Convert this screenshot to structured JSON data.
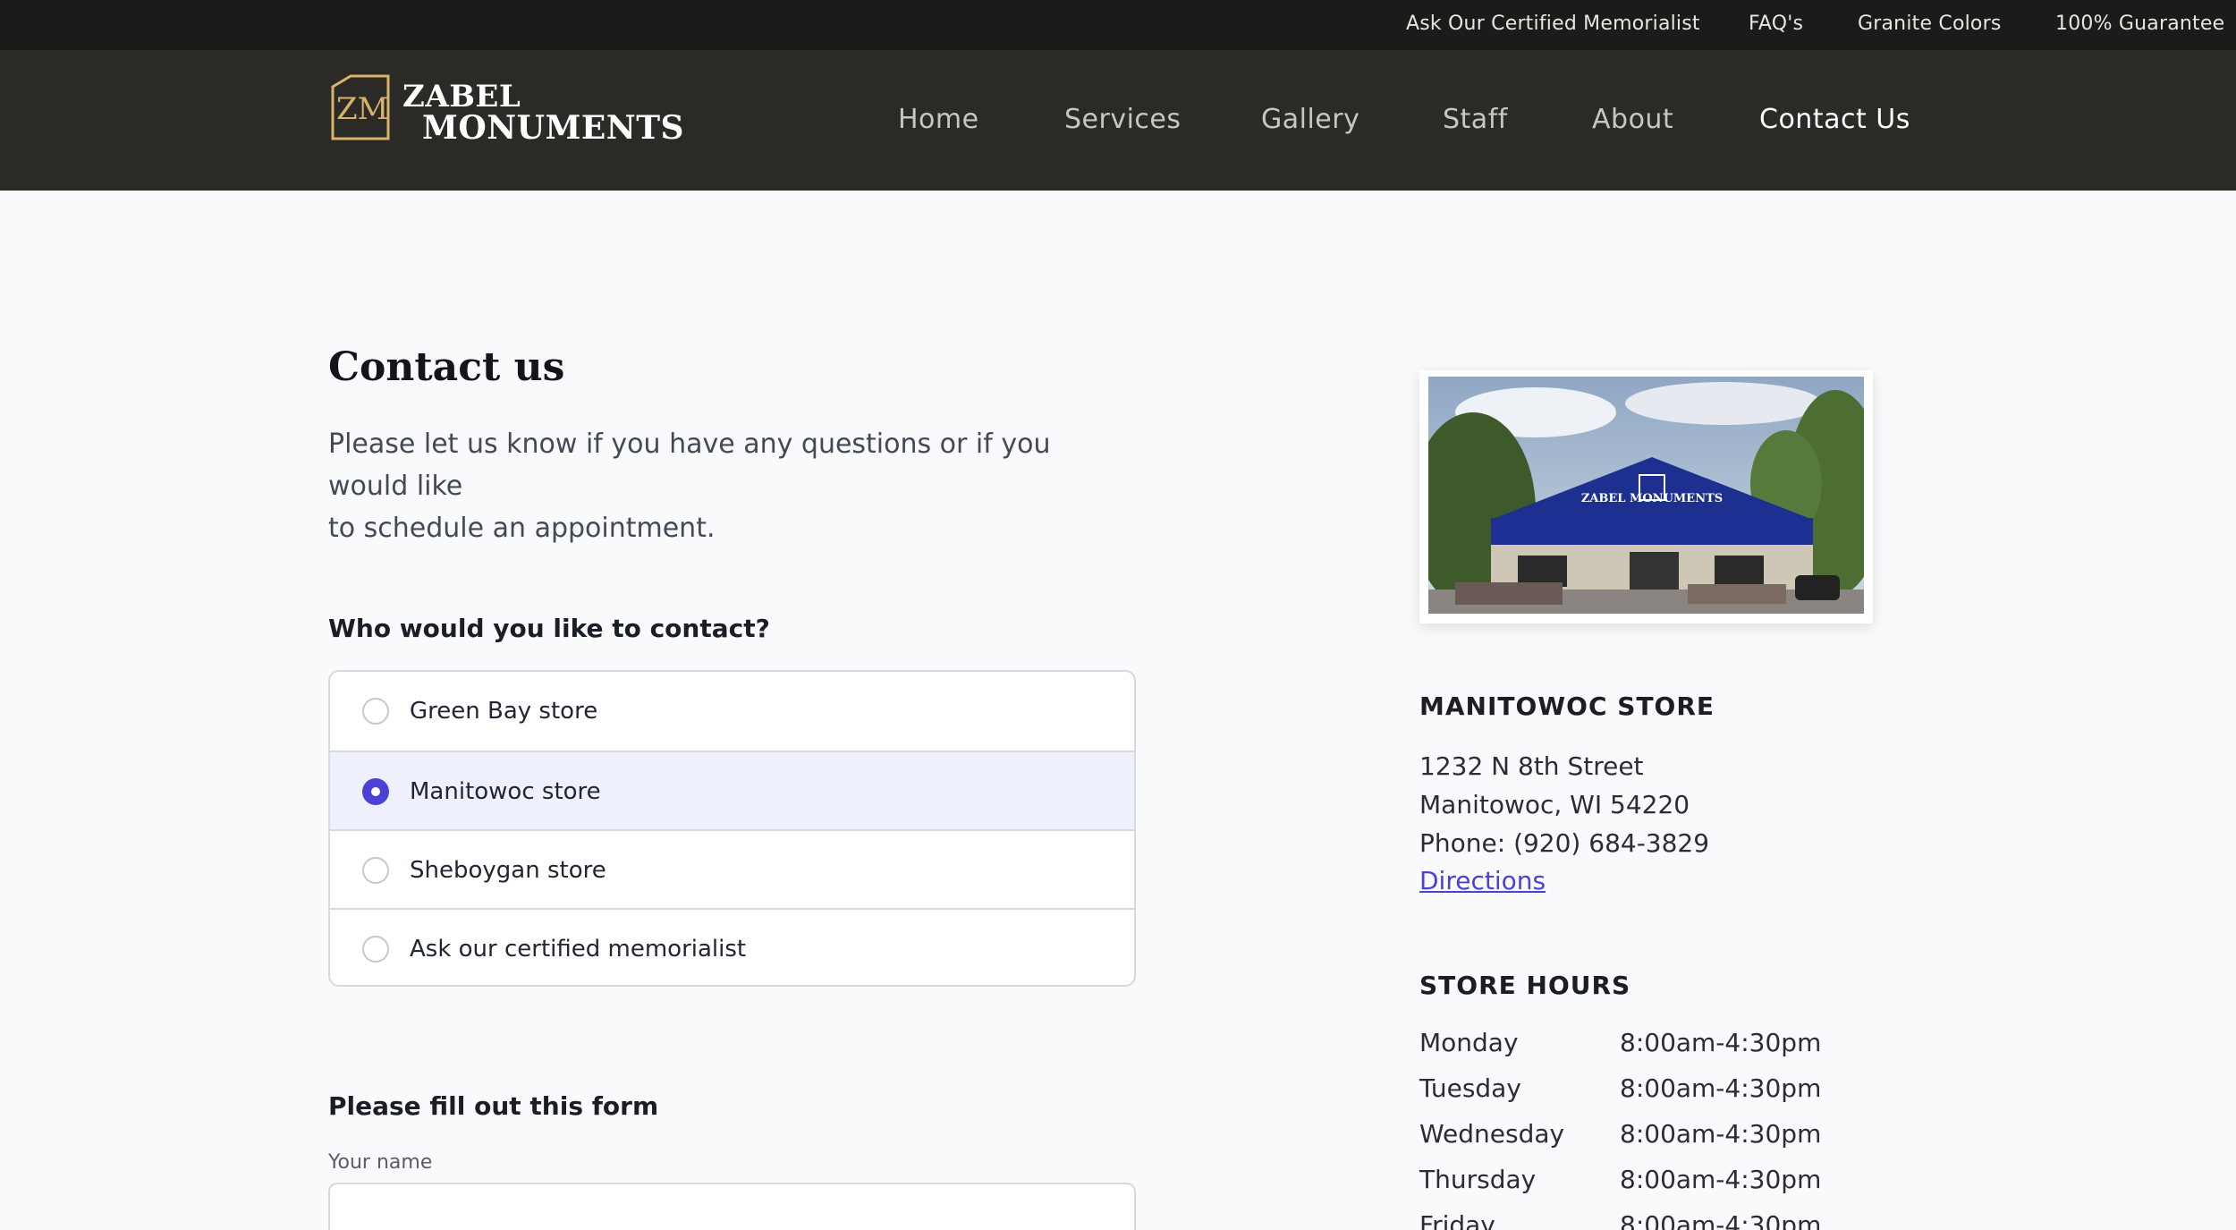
{
  "topbar": {
    "links": [
      "Ask Our Certified Memorialist",
      "FAQ's",
      "Granite Colors",
      "100% Guarantee"
    ]
  },
  "brand": {
    "monogram": "ZM",
    "line1": "ZABEL",
    "line2": "MONUMENTS",
    "accent_color": "#d9b26a"
  },
  "nav": {
    "items": [
      "Home",
      "Services",
      "Gallery",
      "Staff",
      "About",
      "Contact Us"
    ],
    "active": "Contact Us"
  },
  "main": {
    "title": "Contact us",
    "intro_line1": "Please let us know if you have any questions or if you would like",
    "intro_line2": "to schedule an appointment.",
    "contact_question": "Who would you like to contact?",
    "contact_options": [
      "Green Bay store",
      "Manitowoc store",
      "Sheboygan store",
      "Ask our certified memorialist"
    ],
    "selected_option": "Manitowoc store",
    "form_heading": "Please fill out this form",
    "name_label": "Your name",
    "name_value": ""
  },
  "store": {
    "photo_sign": "ZABEL MONUMENTS",
    "heading": "MANITOWOC STORE",
    "address_line1": "1232 N 8th Street",
    "address_line2": "Manitowoc, WI 54220",
    "phone": "Phone: (920) 684-3829",
    "directions_label": "Directions",
    "link_color": "#4a42d6"
  },
  "hours": {
    "heading": "STORE HOURS",
    "rows": [
      {
        "day": "Monday",
        "time": "8:00am-4:30pm"
      },
      {
        "day": "Tuesday",
        "time": "8:00am-4:30pm"
      },
      {
        "day": "Wednesday",
        "time": "8:00am-4:30pm"
      },
      {
        "day": "Thursday",
        "time": "8:00am-4:30pm"
      },
      {
        "day": "Friday",
        "time": "8:00am-4:30pm"
      }
    ]
  }
}
